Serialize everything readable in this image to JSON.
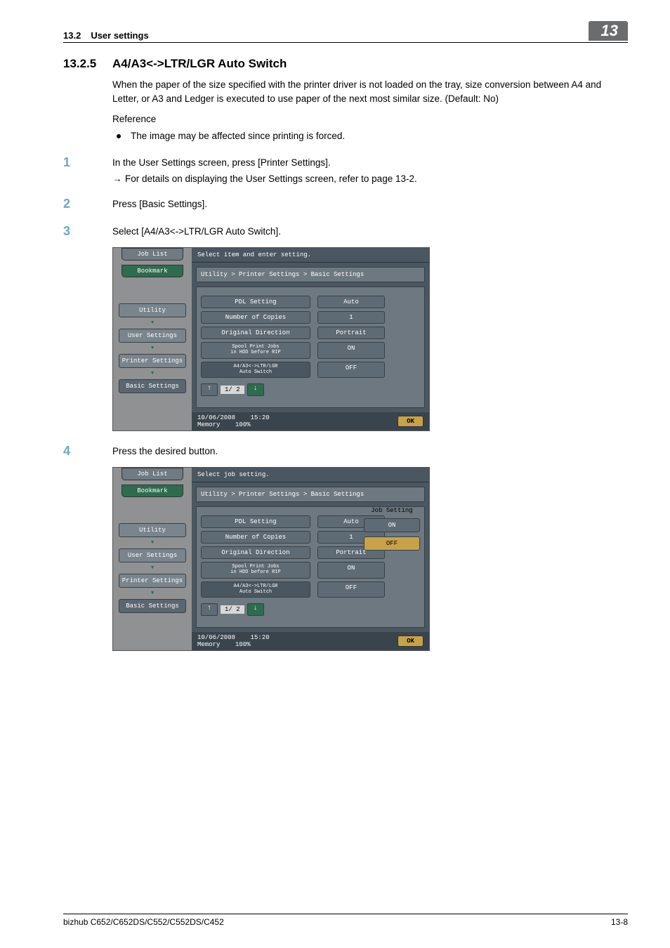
{
  "header": {
    "section": "13.2",
    "title": "User settings",
    "chapter": "13"
  },
  "h2": {
    "num": "13.2.5",
    "title": "A4/A3<->LTR/LGR Auto Switch"
  },
  "intro": "When the paper of the size specified with the printer driver is not loaded on the tray, size conversion between A4 and Letter, or A3 and Ledger is executed to use paper of the next most similar size. (Default: No)",
  "reference_label": "Reference",
  "reference_bullet": "The image may be affected since printing is forced.",
  "steps": [
    {
      "n": "1",
      "text": "In the User Settings screen, press [Printer Settings].",
      "sub": "For details on displaying the User Settings screen, refer to page 13-2."
    },
    {
      "n": "2",
      "text": "Press [Basic Settings]."
    },
    {
      "n": "3",
      "text": "Select [A4/A3<->LTR/LGR Auto Switch]."
    },
    {
      "n": "4",
      "text": "Press the desired button."
    }
  ],
  "screen": {
    "job_list": "Job List",
    "bookmark": "Bookmark",
    "nav": [
      "Utility",
      "User Settings",
      "Printer Settings",
      "Basic Settings"
    ],
    "header1": "Select item and enter setting.",
    "header2": "Select job setting.",
    "breadcrumb": "Utility > Printer Settings > Basic Settings",
    "rows": [
      {
        "label": "PDL Setting",
        "val": "Auto"
      },
      {
        "label": "Number of Copies",
        "val": "1"
      },
      {
        "label": "Original Direction",
        "val": "Portrait"
      },
      {
        "label": "Spool Print Jobs\nin HDD before RIP",
        "val": "ON"
      },
      {
        "label": "A4/A3<->LTR/LGR\nAuto Switch",
        "val": "OFF"
      }
    ],
    "pager": "1/ 2",
    "date": "10/06/2008",
    "time": "15:20",
    "mem": "Memory",
    "mempct": "100%",
    "ok": "OK",
    "job_setting_title": "Job Setting",
    "on": "ON",
    "off": "OFF"
  },
  "footer": {
    "left": "bizhub C652/C652DS/C552/C552DS/C452",
    "right": "13-8"
  }
}
